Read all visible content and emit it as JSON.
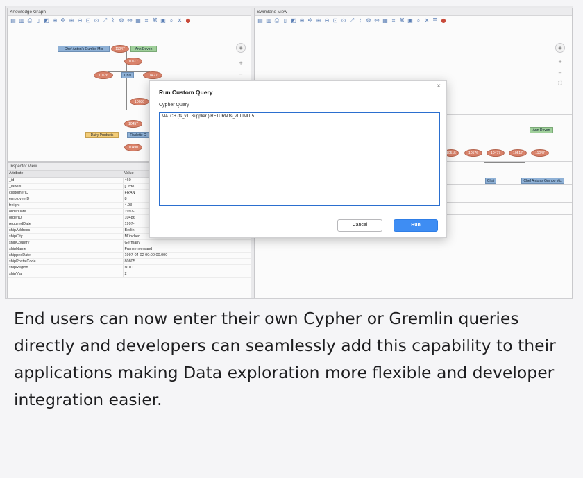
{
  "panels": {
    "knowledge_graph": "Knowledge Graph",
    "swimlane": "Swimlane View",
    "inspector": "Inspector View"
  },
  "graph_nodes": {
    "gumbo": "Chef Anton's Gumbo Mix",
    "n11047": "11047",
    "ann": "Ann Devon",
    "n10517": "10517",
    "n10576": "10576",
    "chai": "Chai",
    "n10477": "10477",
    "n10686": "10686",
    "n10457": "10457",
    "dairy": "Dairy Products",
    "raclette": "Raclette C",
    "n10490": "10490"
  },
  "swimlane_nodes": {
    "ann": "Ann Devon",
    "n10515": "10515",
    "n10576": "10576",
    "n10477": "10477",
    "n10517": "10517",
    "n11047": "11047",
    "chai": "Chai",
    "gumbo": "Chef Anton's Gumbo Mix"
  },
  "inspector": {
    "columns": [
      "Attribute",
      "Value"
    ],
    "rows": [
      [
        "_id",
        "460"
      ],
      [
        "_labels",
        "[Orde"
      ],
      [
        "customerID",
        "FRAN"
      ],
      [
        "employeeID",
        "8"
      ],
      [
        "freight",
        "4.93"
      ],
      [
        "orderDate",
        "1997-"
      ],
      [
        "orderID",
        "10486"
      ],
      [
        "requiredDate",
        "1997-"
      ],
      [
        "shipAddress",
        "Berlin"
      ],
      [
        "shipCity",
        "München"
      ],
      [
        "shipCountry",
        "Germany"
      ],
      [
        "shipName",
        "Frankenversand"
      ],
      [
        "shippedDate",
        "1997-04-02 00:00:00.000"
      ],
      [
        "shipPostalCode",
        "80805"
      ],
      [
        "shipRegion",
        "NULL"
      ],
      [
        "shipVia",
        "2"
      ]
    ]
  },
  "dialog": {
    "title": "Run Custom Query",
    "label": "Cypher Query",
    "query": "MATCH (ts_v1:`Supplier`) RETURN ts_v1 LIMIT 5",
    "cancel": "Cancel",
    "run": "Run",
    "close": "×"
  },
  "caption": "End users can now enter their own Cypher or Gremlin queries directly and developers can seamlessly add this capability to their applications making Data exploration more flexible and developer integration easier."
}
